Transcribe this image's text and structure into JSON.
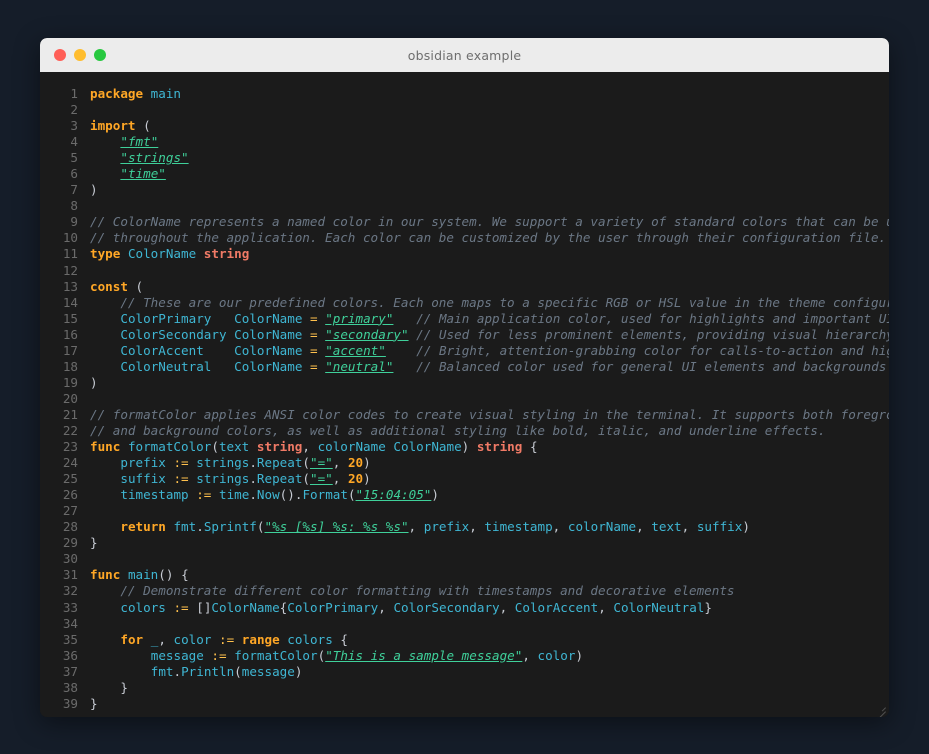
{
  "window": {
    "title": "obsidian example",
    "traffic_lights": [
      {
        "name": "close",
        "color": "#ff5f57"
      },
      {
        "name": "minimize",
        "color": "#ffbd2e"
      },
      {
        "name": "maximize",
        "color": "#28c840"
      }
    ]
  },
  "theme": {
    "page_background": "#151d29",
    "titlebar_background": "#ececec",
    "code_background": "#1b1b1b",
    "titlebar_text": "#6e6e6e",
    "line_number": "#6b6b6b",
    "default_text": "#c8ccd4",
    "keyword": "#ffa726",
    "builtin_type": "#f07a66",
    "identifier": "#3fb6d3",
    "string": "#3fd09a",
    "comment": "#6b7785",
    "number": "#ffa726",
    "operator": "#ffc14d"
  },
  "editor": {
    "language": "go",
    "first_line": 1,
    "last_line": 39,
    "line_count": 39,
    "line_numbers": [
      1,
      2,
      3,
      4,
      5,
      6,
      7,
      8,
      9,
      10,
      11,
      12,
      13,
      14,
      15,
      16,
      17,
      18,
      19,
      20,
      21,
      22,
      23,
      24,
      25,
      26,
      27,
      28,
      29,
      30,
      31,
      32,
      33,
      34,
      35,
      36,
      37,
      38,
      39
    ],
    "lines": [
      "package main",
      "",
      "import (",
      "    \"fmt\"",
      "    \"strings\"",
      "    \"time\"",
      ")",
      "",
      "// ColorName represents a named color in our system. We support a variety of standard colors that can be used",
      "// throughout the application. Each color can be customized by the user through their configuration file.",
      "type ColorName string",
      "",
      "const (",
      "    // These are our predefined colors. Each one maps to a specific RGB or HSL value in the theme configuration.",
      "    ColorPrimary   ColorName = \"primary\"   // Main application color, used for highlights and important UI elements",
      "    ColorSecondary ColorName = \"secondary\" // Used for less prominent elements, providing visual hierarchy",
      "    ColorAccent    ColorName = \"accent\"    // Bright, attention-grabbing color for calls-to-action and highlights",
      "    ColorNeutral   ColorName = \"neutral\"   // Balanced color used for general UI elements and backgrounds",
      ")",
      "",
      "// formatColor applies ANSI color codes to create visual styling in the terminal. It supports both foreground",
      "// and background colors, as well as additional styling like bold, italic, and underline effects.",
      "func formatColor(text string, colorName ColorName) string {",
      "    prefix := strings.Repeat(\"=\", 20)",
      "    suffix := strings.Repeat(\"=\", 20)",
      "    timestamp := time.Now().Format(\"15:04:05\")",
      "",
      "    return fmt.Sprintf(\"%s [%s] %s: %s %s\", prefix, timestamp, colorName, text, suffix)",
      "}",
      "",
      "func main() {",
      "    // Demonstrate different color formatting with timestamps and decorative elements",
      "    colors := []ColorName{ColorPrimary, ColorSecondary, ColorAccent, ColorNeutral}",
      "",
      "    for _, color := range colors {",
      "        message := formatColor(\"This is a sample message\", color)",
      "        fmt.Println(message)",
      "    }",
      "}"
    ]
  }
}
